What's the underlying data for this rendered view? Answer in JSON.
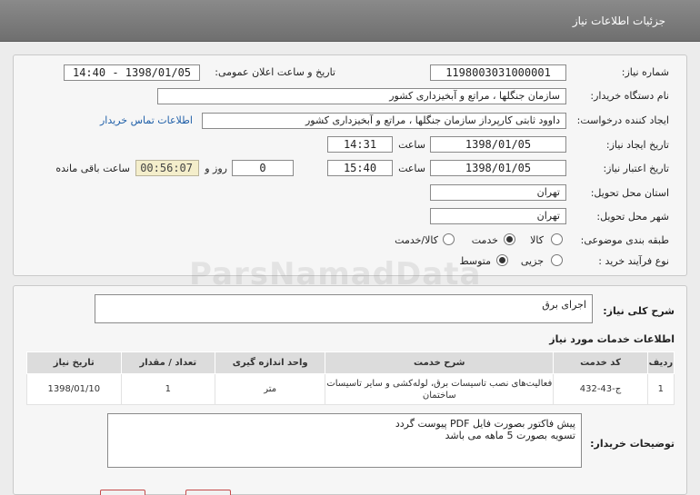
{
  "header": {
    "title": "جزئیات اطلاعات نیاز"
  },
  "form": {
    "need_number": {
      "label": "شماره نیاز:",
      "value": "1198003031000001"
    },
    "announce": {
      "label": "تاریخ و ساعت اعلان عمومی:",
      "value": "1398/01/05 - 14:40"
    },
    "buyer_org": {
      "label": "نام دستگاه خریدار:",
      "value": "سازمان جنگلها ، مراتع و آبخیزداری کشور"
    },
    "requester": {
      "label": "ایجاد کننده درخواست:",
      "value": "داوود  ثابتی کارپرداز سازمان جنگلها ، مراتع و آبخیزداری کشور"
    },
    "contact_link": "اطلاعات تماس خریدار",
    "created": {
      "label": "تاریخ ایجاد نیاز:",
      "date": "1398/01/05",
      "time_label": "ساعت",
      "time": "14:31"
    },
    "validity": {
      "label": "تاریخ اعتبار نیاز:",
      "date": "1398/01/05",
      "time_label": "ساعت",
      "time": "15:40",
      "days": "0",
      "days_label": "روز و",
      "remaining": "00:56:07",
      "remaining_label": "ساعت باقی مانده"
    },
    "province": {
      "label": "استان محل تحویل:",
      "value": "تهران"
    },
    "city": {
      "label": "شهر محل تحویل:",
      "value": "تهران"
    },
    "category": {
      "label": "طبقه بندی موضوعی:",
      "options": [
        "کالا",
        "خدمت",
        "کالا/خدمت"
      ],
      "selected": "خدمت"
    },
    "process": {
      "label": "نوع فرآیند خرید :",
      "options": [
        "جزیی",
        "متوسط"
      ],
      "selected": "متوسط"
    }
  },
  "summary": {
    "label": "شرح کلی نیاز:",
    "value": "اجرای برق"
  },
  "services": {
    "title": "اطلاعات خدمات مورد نیاز",
    "columns": [
      "ردیف",
      "کد خدمت",
      "شرح خدمت",
      "واحد اندازه گیری",
      "تعداد / مقدار",
      "تاریخ نیاز"
    ],
    "rows": [
      {
        "row": "1",
        "code": "ج-43-432",
        "desc": "فعالیت‌های نصب تاسیسات برق، لوله‌کشی و سایر تاسیسات ساختمان",
        "unit": "متر",
        "qty": "1",
        "date": "1398/01/10"
      }
    ]
  },
  "notes": {
    "label": "توضیحات خریدار:",
    "line1": "پیش فاکتور بصورت فایل PDF پیوست گردد",
    "line2": "تسویه بصورت 5 ماهه می باشد"
  },
  "watermark": {
    "text": "ParsNamadData"
  }
}
